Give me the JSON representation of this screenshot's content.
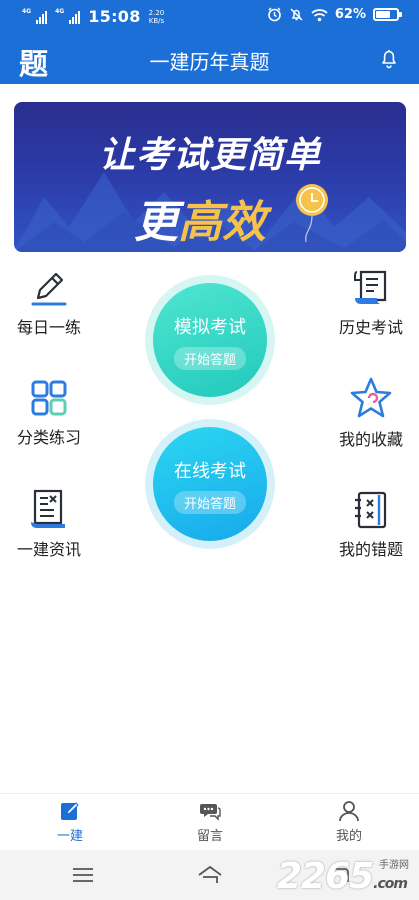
{
  "status_bar": {
    "signal1": "4G",
    "signal2": "4G",
    "time": "15:08",
    "speed_value": "2.20",
    "speed_unit": "KB/s",
    "battery": "62%"
  },
  "header": {
    "logo": "题",
    "title": "一建历年真题"
  },
  "banner": {
    "line1": "让考试更简单",
    "line2_white": "更",
    "line2_yellow": "高效"
  },
  "left_items": [
    {
      "label": "每日一练",
      "icon": "pencil-icon"
    },
    {
      "label": "分类练习",
      "icon": "category-icon"
    },
    {
      "label": "一建资讯",
      "icon": "news-icon"
    }
  ],
  "right_items": [
    {
      "label": "历史考试",
      "icon": "scroll-icon"
    },
    {
      "label": "我的收藏",
      "icon": "star-icon"
    },
    {
      "label": "我的错题",
      "icon": "wrong-book-icon"
    }
  ],
  "circles": [
    {
      "title": "模拟考试",
      "button": "开始答题"
    },
    {
      "title": "在线考试",
      "button": "开始答题"
    }
  ],
  "bottom_nav": [
    {
      "label": "一建",
      "icon": "edit-icon",
      "active": true
    },
    {
      "label": "留言",
      "icon": "chat-icon",
      "active": false
    },
    {
      "label": "我的",
      "icon": "user-icon",
      "active": false
    }
  ],
  "watermark": {
    "text": "2265",
    "suffix": ".com",
    "sub": "手游网"
  },
  "colors": {
    "primary": "#1c6fd6",
    "accent_teal": "#22c9bd",
    "accent_cyan": "#16a9ec",
    "banner_yellow": "#f6c24c"
  }
}
